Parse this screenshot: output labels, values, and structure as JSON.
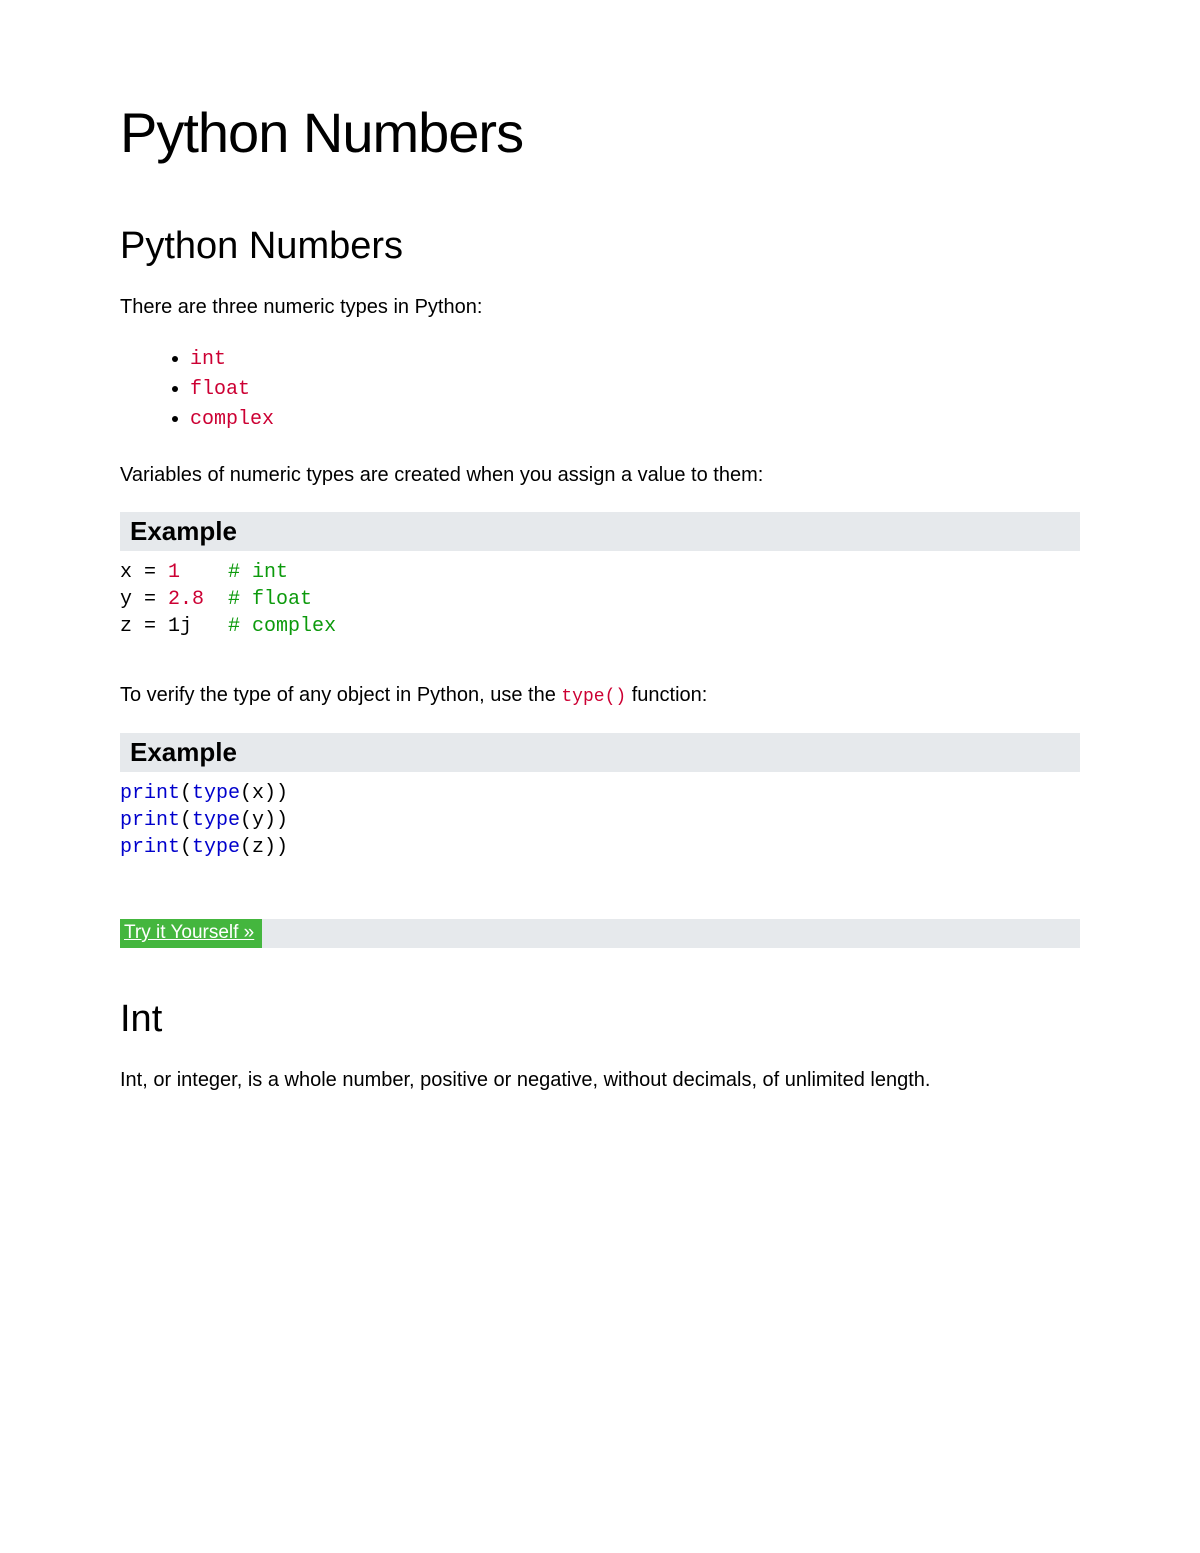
{
  "page": {
    "title": "Python Numbers"
  },
  "section1": {
    "heading": "Python Numbers",
    "intro": "There are three numeric types in Python:",
    "types": [
      "int",
      "float",
      "complex"
    ],
    "after_list": "Variables of numeric types are created when you assign a value to them:"
  },
  "example1": {
    "heading": "Example",
    "lines": [
      {
        "lhs": "x = ",
        "val": "1",
        "val_color": "red",
        "pad": "    ",
        "comment": "# int"
      },
      {
        "lhs": "y = ",
        "val": "2.8",
        "val_color": "red",
        "pad": "  ",
        "comment": "# float"
      },
      {
        "lhs": "z = ",
        "val": "1j",
        "val_color": "black",
        "pad": "   ",
        "comment": "# complex"
      }
    ]
  },
  "verify": {
    "before": "To verify the type of any object in Python, use the ",
    "code": "type()",
    "after": " function:"
  },
  "example2": {
    "heading": "Example",
    "lines": [
      {
        "fn": "print",
        "arg_fn": "type",
        "arg_var": "x"
      },
      {
        "fn": "print",
        "arg_fn": "type",
        "arg_var": "y"
      },
      {
        "fn": "print",
        "arg_fn": "type",
        "arg_var": "z"
      }
    ],
    "try_label": "Try it Yourself »"
  },
  "section_int": {
    "heading": "Int",
    "body": "Int, or integer, is a whole number, positive or negative, without decimals, of unlimited length."
  }
}
